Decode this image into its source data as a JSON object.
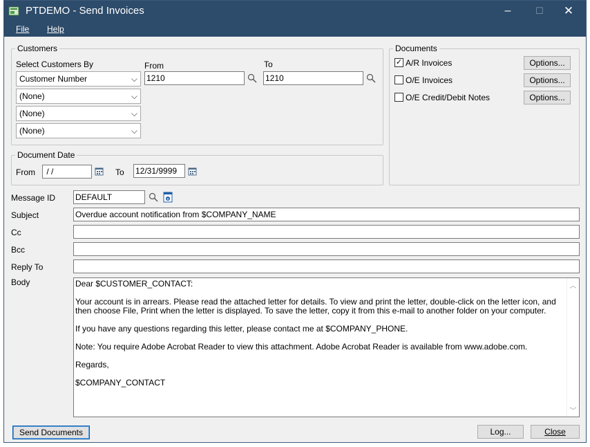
{
  "window": {
    "title": "PTDEMO - Send Invoices",
    "minimize": "–",
    "maximize": "☐",
    "close": "✕"
  },
  "menu": {
    "file": "File",
    "help": "Help"
  },
  "customers": {
    "group_label": "Customers",
    "select_by_label": "Select Customers By",
    "from_label": "From",
    "to_label": "To",
    "select_by_value": "Customer Number",
    "from_value": "1210",
    "to_value": "1210",
    "extra_selects": [
      "(None)",
      "(None)",
      "(None)"
    ]
  },
  "documents": {
    "group_label": "Documents",
    "items": [
      {
        "label": "A/R Invoices",
        "checked": true,
        "options_label": "Options..."
      },
      {
        "label": "O/E Invoices",
        "checked": false,
        "options_label": "Options..."
      },
      {
        "label": "O/E Credit/Debit Notes",
        "checked": false,
        "options_label": "Options..."
      }
    ]
  },
  "document_date": {
    "group_label": "Document Date",
    "from_label": "From",
    "from_value": " / /",
    "to_label": "To",
    "to_value": "12/31/9999"
  },
  "email": {
    "message_id_label": "Message ID",
    "message_id_value": "DEFAULT",
    "subject_label": "Subject",
    "subject_value": "Overdue account notification from $COMPANY_NAME",
    "cc_label": "Cc",
    "cc_value": "",
    "bcc_label": "Bcc",
    "bcc_value": "",
    "reply_to_label": "Reply To",
    "reply_to_value": "",
    "body_label": "Body",
    "body_paragraphs": [
      "Dear $CUSTOMER_CONTACT:",
      "Your account is in arrears. Please read the attached letter for details. To view and print the letter, double-click on the letter icon, and then choose File, Print when the letter is displayed. To save the letter, copy it from this e-mail to another folder on your computer.",
      "If you have any questions regarding this letter, please contact me at $COMPANY_PHONE.",
      "Note: You require Adobe Acrobat Reader to view this attachment. Adobe Acrobat Reader is available from www.adobe.com.",
      "Regards,",
      "$COMPANY_CONTACT"
    ]
  },
  "buttons": {
    "send": "Send Documents",
    "log": "Log...",
    "close": "Close"
  },
  "icons": {
    "finder": "magnifier-icon",
    "calendar": "calendar-icon",
    "info": "info-icon"
  }
}
